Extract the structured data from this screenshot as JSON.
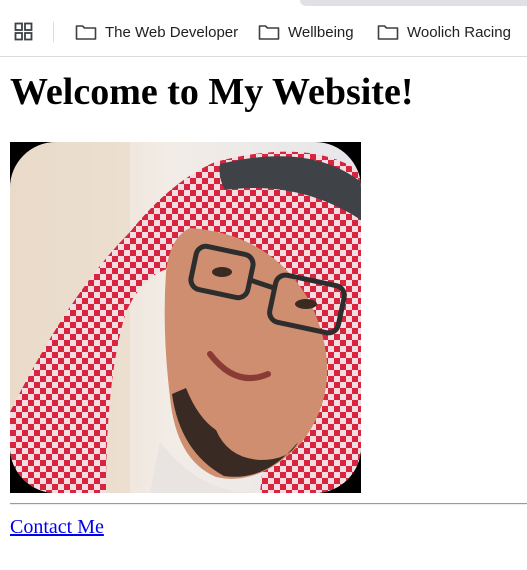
{
  "bookmarks_bar": {
    "apps_icon": "apps-grid-icon",
    "items": [
      {
        "label": "The Web Developer",
        "icon": "folder-icon"
      },
      {
        "label": "Wellbeing",
        "icon": "folder-icon"
      },
      {
        "label": "Woolich Racing",
        "icon": "folder-icon"
      }
    ]
  },
  "page": {
    "title": "Welcome to My Website!",
    "photo": {
      "subject": "portrait-photo"
    },
    "contact_link": "Contact Me"
  },
  "colors": {
    "link": "#0000ee",
    "bookmark_text": "#202124",
    "divider": "#9a9a9a"
  }
}
